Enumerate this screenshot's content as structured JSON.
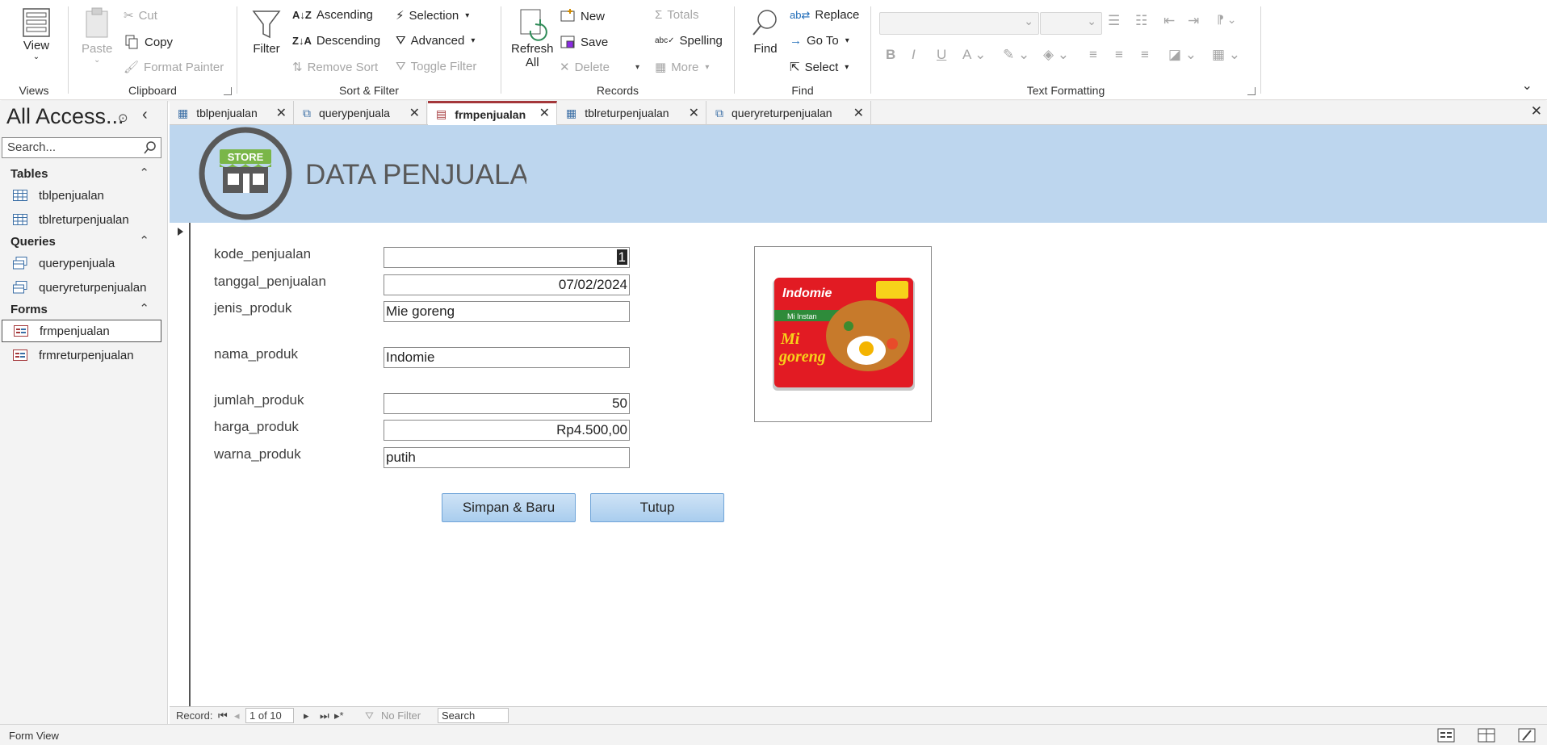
{
  "ribbon": {
    "views": {
      "view_label": "View",
      "group_label": "Views"
    },
    "clipboard": {
      "paste": "Paste",
      "cut": "Cut",
      "copy": "Copy",
      "format_painter": "Format Painter",
      "group_label": "Clipboard"
    },
    "sort_filter": {
      "filter": "Filter",
      "ascending": "Ascending",
      "descending": "Descending",
      "remove_sort": "Remove Sort",
      "selection": "Selection",
      "advanced": "Advanced",
      "toggle_filter": "Toggle Filter",
      "group_label": "Sort & Filter"
    },
    "records": {
      "refresh_line1": "Refresh",
      "refresh_line2": "All",
      "new": "New",
      "save": "Save",
      "delete": "Delete",
      "totals": "Totals",
      "spelling": "Spelling",
      "more": "More",
      "group_label": "Records"
    },
    "find": {
      "find": "Find",
      "replace": "Replace",
      "goto": "Go To",
      "select": "Select",
      "group_label": "Find"
    },
    "text_formatting": {
      "bold": "B",
      "italic": "I",
      "underline": "U",
      "group_label": "Text Formatting"
    }
  },
  "nav": {
    "title": "All Access...",
    "search_placeholder": "Search...",
    "sections": [
      {
        "label": "Tables",
        "items": [
          "tblpenjualan",
          "tblreturpenjualan"
        ]
      },
      {
        "label": "Queries",
        "items": [
          "querypenjuala",
          "queryreturpenjualan"
        ]
      },
      {
        "label": "Forms",
        "items": [
          "frmpenjualan",
          "frmreturpenjualan"
        ]
      }
    ]
  },
  "tabs": [
    {
      "label": "tblpenjualan",
      "kind": "table"
    },
    {
      "label": "querypenjuala",
      "kind": "query"
    },
    {
      "label": "frmpenjualan",
      "kind": "form",
      "active": true
    },
    {
      "label": "tblreturpenjualan",
      "kind": "table"
    },
    {
      "label": "queryreturpenjualan",
      "kind": "query"
    }
  ],
  "form": {
    "logo_text": "STORE",
    "title": "DATA PENJUALA",
    "fields": [
      {
        "label": "kode_penjualan",
        "value": "1"
      },
      {
        "label": "tanggal_penjualan",
        "value": "07/02/2024"
      },
      {
        "label": "jenis_produk",
        "value": "Mie goreng"
      },
      {
        "label": "nama_produk",
        "value": "Indomie"
      },
      {
        "label": "jumlah_produk",
        "value": "50"
      },
      {
        "label": "harga_produk",
        "value": "Rp4.500,00"
      },
      {
        "label": "warna_produk",
        "value": "putih"
      }
    ],
    "product_image": {
      "brand": "Indomie",
      "line1": "Mi Instan",
      "line2": "Mi",
      "line3": "goreng"
    },
    "buttons": {
      "save_new": "Simpan & Baru",
      "close": "Tutup"
    }
  },
  "record_nav": {
    "record_label": "Record:",
    "position": "1 of 10",
    "no_filter": "No Filter",
    "search": "Search"
  },
  "status": {
    "text": "Form View"
  },
  "colors": {
    "header_band": "#bdd6ee",
    "active_tab_accent": "#a4373a",
    "button": "#a9cdee"
  }
}
